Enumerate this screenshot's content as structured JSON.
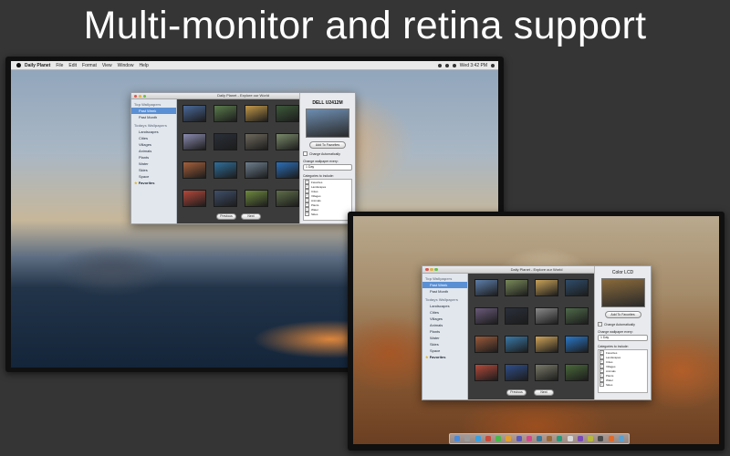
{
  "headline": "Multi-monitor and retina support",
  "menubar": {
    "app_name": "Daily Planet",
    "items": [
      "File",
      "Edit",
      "Format",
      "View",
      "Window",
      "Help"
    ],
    "clock": "Wed 3:42 PM"
  },
  "window_left": {
    "title": "Daily Planet - Explore our World",
    "sidebar": {
      "heading_top": "Top Wallpapers",
      "top_items": [
        {
          "label": "Past Week",
          "selected": true
        },
        {
          "label": "Past Month",
          "selected": false
        }
      ],
      "heading_today": "Todays Wallpapers",
      "today_items": [
        "Landscapes",
        "Cities",
        "Villages",
        "Animals",
        "Plants",
        "Water",
        "Skies",
        "Space"
      ],
      "favorites": "Favorites"
    },
    "thumb_colors": [
      "#4a6a9a",
      "#5b7d4c",
      "#c49a4a",
      "#3d5a3a",
      "#8b8bb0",
      "#2a2f38",
      "#6f6a5e",
      "#7a8a6a",
      "#a5603a",
      "#2f6f9a",
      "#6e7f8e",
      "#2b6fb8",
      "#b5483a",
      "#3f4f6a",
      "#6f8a3f",
      "#5f6f4a"
    ],
    "prev_button": "Previous",
    "next_button": "Next",
    "monitor_name": "DELL U2412M",
    "preview_color": "#6d8db0",
    "add_favorites": "Add To Favorites",
    "change_auto": "Change Automatically",
    "change_auto_checked": false,
    "change_every_label": "Change wallpaper every:",
    "change_every_value": "1 Day",
    "categories_label": "Categories to include:",
    "categories": [
      "Favorites",
      "Landscapes",
      "Cities",
      "Villages",
      "Animals",
      "Plants",
      "Water",
      "Skies"
    ]
  },
  "window_right": {
    "title": "Daily Planet - Explore our World",
    "sidebar": {
      "heading_top": "Top Wallpapers",
      "top_items": [
        {
          "label": "Past Week",
          "selected": true
        },
        {
          "label": "Past Month",
          "selected": false
        }
      ],
      "heading_today": "Todays Wallpapers",
      "today_items": [
        "Landscapes",
        "Cities",
        "Villages",
        "Animals",
        "Plants",
        "Water",
        "Skies",
        "Space"
      ],
      "favorites": "Favorites"
    },
    "thumb_colors": [
      "#5d7faa",
      "#7a8a5a",
      "#c9a35a",
      "#2f4d6a",
      "#6a5a7a",
      "#2a2f3a",
      "#8a8a8a",
      "#4f6a4a",
      "#9a5a3a",
      "#3a7aa8",
      "#d0a45a",
      "#2a78c8",
      "#b44a3a",
      "#2f4f8a",
      "#7a7a6a",
      "#4a6a3a"
    ],
    "prev_button": "Previous",
    "next_button": "Next",
    "monitor_name": "Color LCD",
    "preview_color": "#8a6a3a",
    "add_favorites": "Add To Favorites",
    "change_auto": "Change Automatically",
    "change_auto_checked": true,
    "change_every_label": "Change wallpaper every:",
    "change_every_value": "1 Day",
    "categories_label": "Categories to include:",
    "categories": [
      "Favorites",
      "Landscapes",
      "Cities",
      "Villages",
      "Animals",
      "Plants",
      "Water",
      "Skies"
    ]
  },
  "dock_colors": [
    "#4a8ad8",
    "#9a9a9a",
    "#3aa0e0",
    "#c84a3a",
    "#4ab84a",
    "#e0a030",
    "#5a5ab8",
    "#d04a8a",
    "#3a7a9a",
    "#9a6a3a",
    "#2a9a7a",
    "#d8d8d8",
    "#7a4ab8",
    "#b8b83a",
    "#4a4a4a",
    "#e06a2a",
    "#5aa0d0"
  ]
}
